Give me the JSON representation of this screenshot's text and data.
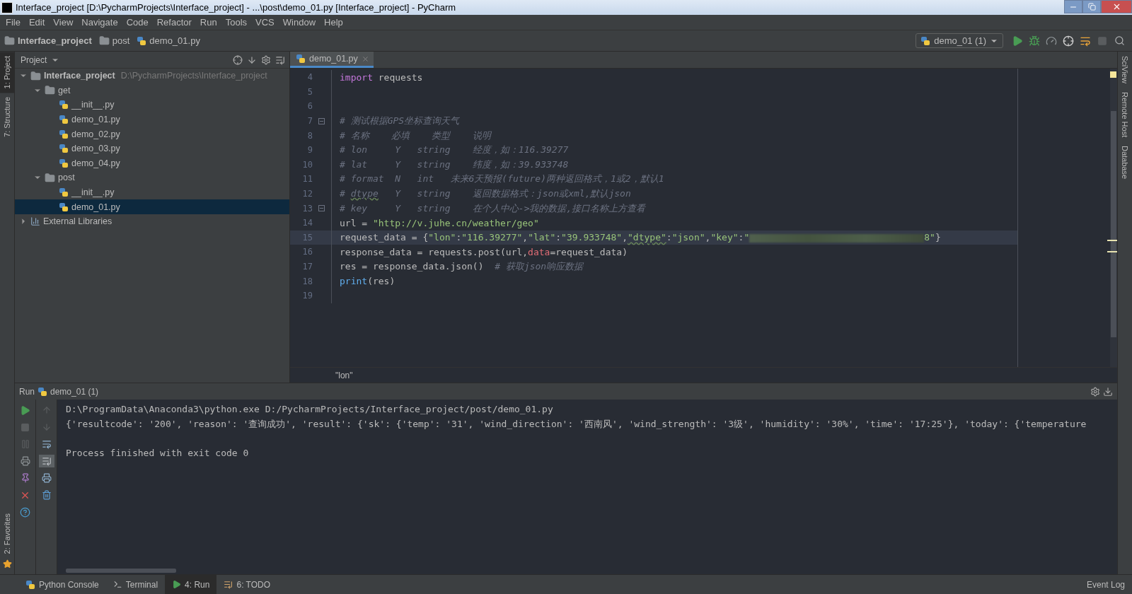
{
  "window": {
    "title": "Interface_project [D:\\PycharmProjects\\Interface_project] - ...\\post\\demo_01.py [Interface_project] - PyCharm"
  },
  "menu": [
    "File",
    "Edit",
    "View",
    "Navigate",
    "Code",
    "Refactor",
    "Run",
    "Tools",
    "VCS",
    "Window",
    "Help"
  ],
  "breadcrumbs": [
    {
      "label": "Interface_project",
      "kind": "folder"
    },
    {
      "label": "post",
      "kind": "folder"
    },
    {
      "label": "demo_01.py",
      "kind": "python"
    }
  ],
  "run_config": "demo_01 (1)",
  "left_tool_tabs": [
    {
      "label": "1: Project",
      "selected": true
    },
    {
      "label": "7: Structure",
      "selected": false
    }
  ],
  "left_bottom_tool_tabs": [
    {
      "label": "2: Favorites",
      "selected": false
    }
  ],
  "right_tool_tabs": [
    {
      "label": "SciView"
    },
    {
      "label": "Remote Host"
    },
    {
      "label": "Database"
    }
  ],
  "project_panel": {
    "title": "Project",
    "tree": [
      {
        "label": "Interface_project",
        "path": "D:\\PycharmProjects\\Interface_project",
        "kind": "folder",
        "expanded": true,
        "selected": false,
        "children": [
          {
            "label": "get",
            "kind": "folder",
            "expanded": true,
            "selected": false,
            "children": [
              {
                "label": "__init__.py",
                "kind": "python",
                "selected": false
              },
              {
                "label": "demo_01.py",
                "kind": "python",
                "selected": false
              },
              {
                "label": "demo_02.py",
                "kind": "python",
                "selected": false
              },
              {
                "label": "demo_03.py",
                "kind": "python",
                "selected": false
              },
              {
                "label": "demo_04.py",
                "kind": "python",
                "selected": false
              }
            ]
          },
          {
            "label": "post",
            "kind": "folder",
            "expanded": true,
            "selected": false,
            "children": [
              {
                "label": "__init__.py",
                "kind": "python",
                "selected": false
              },
              {
                "label": "demo_01.py",
                "kind": "python",
                "selected": true
              }
            ]
          }
        ]
      },
      {
        "label": "External Libraries",
        "kind": "library",
        "expanded": false,
        "selected": false
      }
    ]
  },
  "editor": {
    "tab": "demo_01.py",
    "footer": "\"lon\"",
    "lines": [
      {
        "number": "4",
        "current": false,
        "tokens": [
          {
            "kind": "keyword",
            "text": "import"
          },
          {
            "kind": "plain",
            "text": " requests"
          }
        ]
      },
      {
        "number": "5",
        "current": false
      },
      {
        "number": "6",
        "current": false
      },
      {
        "number": "7",
        "current": false,
        "fold": true,
        "tokens": [
          {
            "kind": "comment",
            "text": "# 测试根据GPS坐标查询天气"
          }
        ]
      },
      {
        "number": "8",
        "current": false,
        "tokens": [
          {
            "kind": "comment",
            "text": "# 名称    必填    类型    说明"
          }
        ]
      },
      {
        "number": "9",
        "current": false,
        "tokens": [
          {
            "kind": "comment",
            "text": "# lon     Y   string    经度，如：116.39277"
          }
        ]
      },
      {
        "number": "10",
        "current": false,
        "tokens": [
          {
            "kind": "comment",
            "text": "# lat     Y   string    纬度，如：39.933748"
          }
        ]
      },
      {
        "number": "11",
        "current": false,
        "tokens": [
          {
            "kind": "comment",
            "text": "# format  N   int   未来6天预报(future)两种返回格式，1或2，默认1"
          }
        ]
      },
      {
        "number": "12",
        "current": false,
        "tokens": [
          {
            "kind": "comment",
            "text": "# "
          },
          {
            "kind": "comment-typo",
            "text": "dtype"
          },
          {
            "kind": "comment",
            "text": "   Y   string    返回数据格式：json或xml,默认json"
          }
        ]
      },
      {
        "number": "13",
        "current": false,
        "fold": true,
        "tokens": [
          {
            "kind": "comment",
            "text": "# key     Y   string    在个人中心->我的数据,接口名称上方查看"
          }
        ]
      },
      {
        "number": "14",
        "current": false,
        "tokens": [
          {
            "kind": "plain",
            "text": "url = "
          },
          {
            "kind": "string",
            "text": "\"http://v.juhe.cn/weather/geo\""
          }
        ]
      },
      {
        "number": "15",
        "current": true,
        "tokens": [
          {
            "kind": "plain",
            "text": "request_data = {"
          },
          {
            "kind": "string",
            "text": "\"lon\""
          },
          {
            "kind": "plain",
            "text": ":"
          },
          {
            "kind": "string",
            "text": "\"116.39277\""
          },
          {
            "kind": "plain",
            "text": ","
          },
          {
            "kind": "string",
            "text": "\"lat\""
          },
          {
            "kind": "plain",
            "text": ":"
          },
          {
            "kind": "string",
            "text": "\"39.933748\""
          },
          {
            "kind": "plain",
            "text": ","
          },
          {
            "kind": "string-typo",
            "text": "\"dtype\""
          },
          {
            "kind": "plain",
            "text": ":"
          },
          {
            "kind": "string",
            "text": "\"json\""
          },
          {
            "kind": "plain",
            "text": ","
          },
          {
            "kind": "string",
            "text": "\"key\""
          },
          {
            "kind": "plain",
            "text": ":"
          },
          {
            "kind": "string",
            "text": "\""
          },
          {
            "kind": "redacted"
          },
          {
            "kind": "string",
            "text": "8\""
          },
          {
            "kind": "plain",
            "text": "}"
          }
        ]
      },
      {
        "number": "16",
        "current": false,
        "tokens": [
          {
            "kind": "plain",
            "text": "response_data = requests.post(url,"
          },
          {
            "kind": "param",
            "text": "data"
          },
          {
            "kind": "plain",
            "text": "=request_data)"
          }
        ]
      },
      {
        "number": "17",
        "current": false,
        "tokens": [
          {
            "kind": "plain",
            "text": "res = response_data.json()  "
          },
          {
            "kind": "comment",
            "text": "# 获取json响应数据"
          }
        ]
      },
      {
        "number": "18",
        "current": false,
        "tokens": [
          {
            "kind": "builtin",
            "text": "print"
          },
          {
            "kind": "plain",
            "text": "(res)"
          }
        ]
      },
      {
        "number": "19",
        "current": false
      }
    ]
  },
  "run_panel": {
    "title": "Run",
    "config": "demo_01 (1)",
    "output": [
      {
        "kind": "command",
        "text": "D:\\ProgramData\\Anaconda3\\python.exe D:/PycharmProjects/Interface_project/post/demo_01.py"
      },
      {
        "kind": "output",
        "text": "{'resultcode': '200', 'reason': '查询成功', 'result': {'sk': {'temp': '31', 'wind_direction': '西南风', 'wind_strength': '3级', 'humidity': '30%', 'time': '17:25'}, 'today': {'temperature"
      },
      {
        "kind": "status",
        "text": "Process finished with exit code 0"
      }
    ]
  },
  "bottom_tabs": [
    {
      "label": "Python Console",
      "kind": "python",
      "selected": false
    },
    {
      "label": "Terminal",
      "kind": "terminal",
      "selected": false
    },
    {
      "label": "4: Run",
      "kind": "run",
      "selected": true
    },
    {
      "label": "6: TODO",
      "kind": "todo",
      "selected": false
    }
  ],
  "event_log": "Event Log"
}
